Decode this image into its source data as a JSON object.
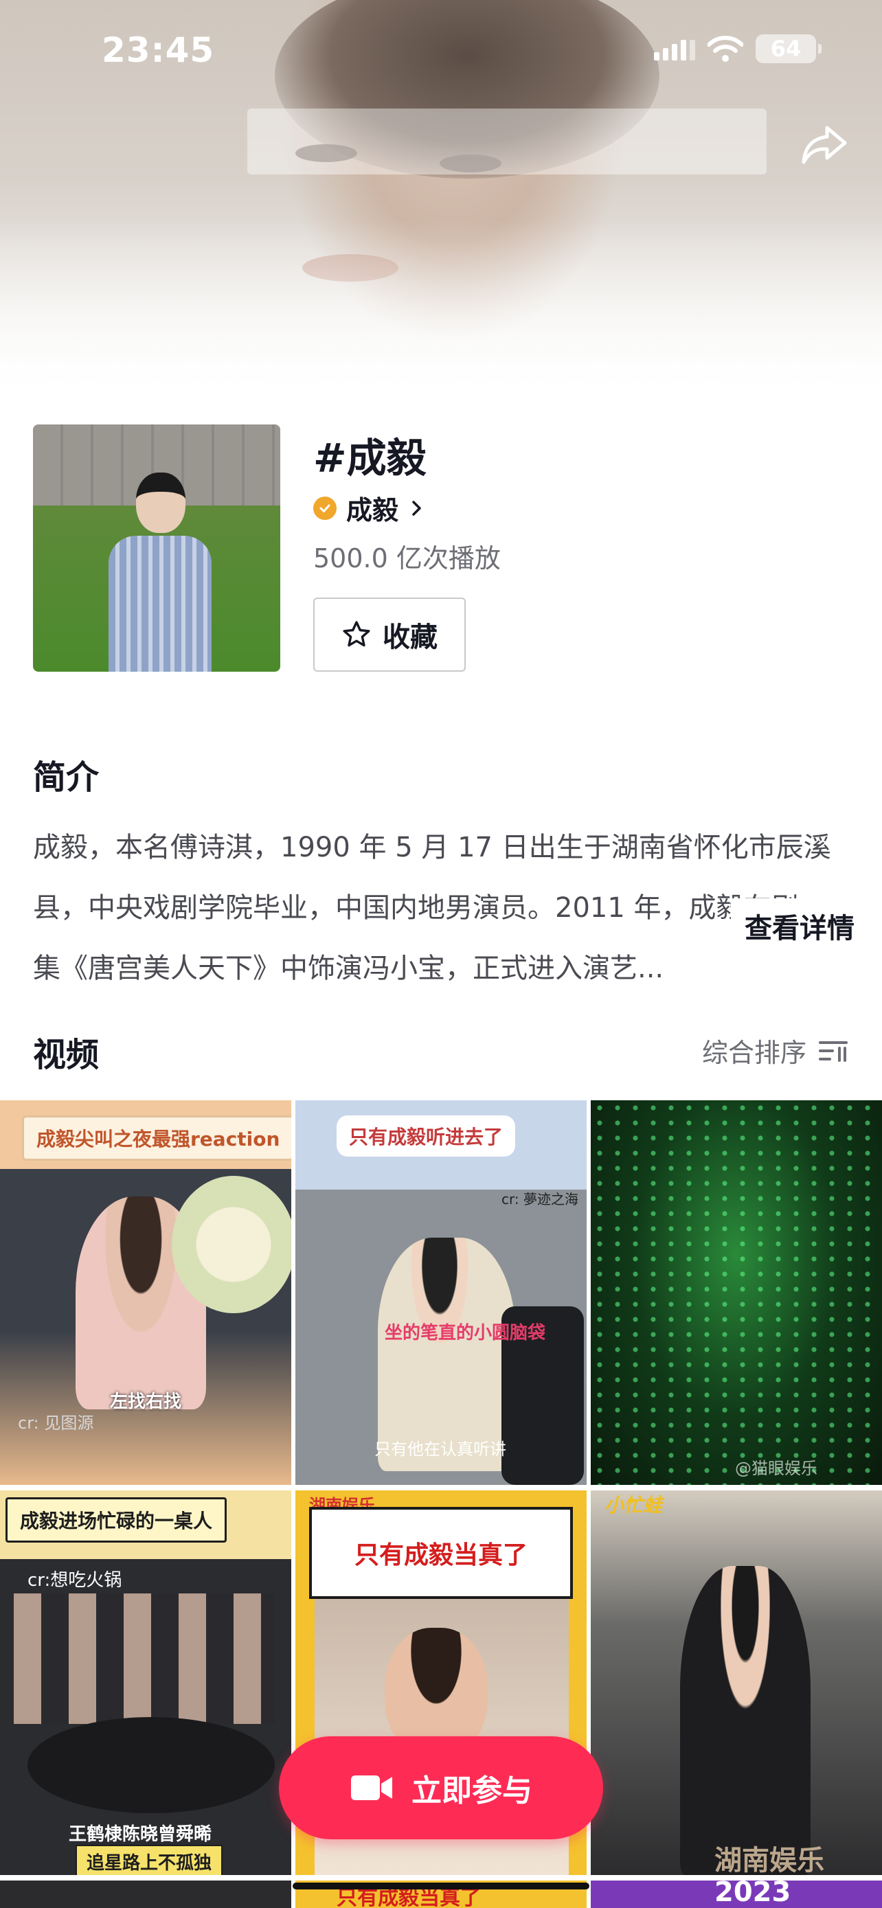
{
  "status_bar": {
    "time": "23:45",
    "battery": "64"
  },
  "header": {
    "share_icon": "share-arrow-icon"
  },
  "topic": {
    "title": "#成毅",
    "creator": "成毅",
    "play_count": "500.0 亿次播放",
    "favorite_label": "收藏"
  },
  "intro": {
    "heading": "简介",
    "lines": [
      "成毅，本名傅诗淇，1990 年 5 月 17 日出生于湖南省怀化市辰溪",
      "县，中央戏剧学院毕业，中国内地男演员。2011 年，成毅在剧",
      "集《唐宫美人天下》中饰演冯小宝，正式进入演艺..."
    ],
    "more": "查看详情"
  },
  "videos": {
    "heading": "视频",
    "sort_label": "综合排序",
    "tiles": [
      {
        "caption": "成毅尖叫之夜最强reaction",
        "sub": "左找右找",
        "credit": "cr: 见图源"
      },
      {
        "caption": "只有成毅听进去了",
        "sub": "坐的笔直的小圆脑袋",
        "credit": "只有他在认真听讲",
        "cr": "cr: 夢迹之海"
      },
      {
        "credit": "@猫眼娱乐"
      },
      {
        "caption": "成毅进场忙碌的一桌人",
        "cr": "cr:想吃火锅",
        "sub": "王鹤棣陈晓曾舜晞",
        "bottom": "追星路上不孤独"
      },
      {
        "brand": "湖南娱乐",
        "caption": "只有成毅当真了"
      },
      {
        "caption": "小忙蛙",
        "credit": "湖南娱乐"
      },
      {},
      {
        "caption": "只有成毅当真了"
      },
      {
        "caption": "2023"
      }
    ]
  },
  "cta": {
    "label": "立即参与"
  },
  "colors": {
    "accent": "#fe2c55",
    "verified": "#f0a72b"
  }
}
